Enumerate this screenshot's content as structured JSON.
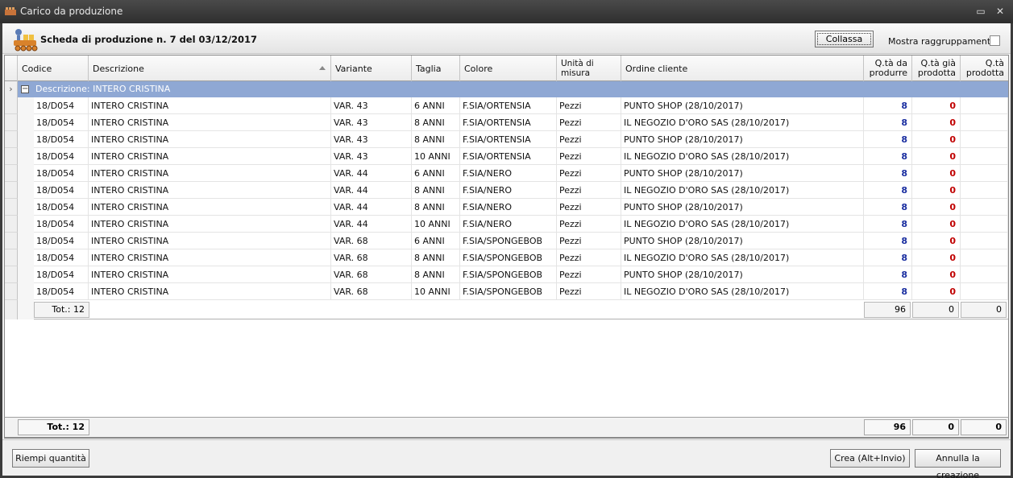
{
  "window": {
    "title": "Carico da produzione"
  },
  "header": {
    "title": "Scheda di produzione n. 7 del 03/12/2017",
    "collapse_label": "Collassa",
    "grouping_label": "Mostra raggruppamento:"
  },
  "columns": [
    "Codice",
    "Descrizione",
    "Variante",
    "Taglia",
    "Colore",
    "Unità di misura",
    "Ordine cliente",
    "Q.tà da produrre",
    "Q.tà già prodotta",
    "Q.tà prodotta"
  ],
  "group": {
    "label": "Descrizione: INTERO CRISTINA"
  },
  "rows": [
    [
      "18/D054",
      "INTERO CRISTINA",
      "VAR. 43",
      "6 ANNI",
      "F.SIA/ORTENSIA",
      "Pezzi",
      "PUNTO SHOP (28/10/2017)",
      "8",
      "0",
      ""
    ],
    [
      "18/D054",
      "INTERO CRISTINA",
      "VAR. 43",
      "8 ANNI",
      "F.SIA/ORTENSIA",
      "Pezzi",
      "IL NEGOZIO D'ORO SAS (28/10/2017)",
      "8",
      "0",
      ""
    ],
    [
      "18/D054",
      "INTERO CRISTINA",
      "VAR. 43",
      "8 ANNI",
      "F.SIA/ORTENSIA",
      "Pezzi",
      "PUNTO SHOP (28/10/2017)",
      "8",
      "0",
      ""
    ],
    [
      "18/D054",
      "INTERO CRISTINA",
      "VAR. 43",
      "10 ANNI",
      "F.SIA/ORTENSIA",
      "Pezzi",
      "IL NEGOZIO D'ORO SAS (28/10/2017)",
      "8",
      "0",
      ""
    ],
    [
      "18/D054",
      "INTERO CRISTINA",
      "VAR. 44",
      "6 ANNI",
      "F.SIA/NERO",
      "Pezzi",
      "PUNTO SHOP (28/10/2017)",
      "8",
      "0",
      ""
    ],
    [
      "18/D054",
      "INTERO CRISTINA",
      "VAR. 44",
      "8 ANNI",
      "F.SIA/NERO",
      "Pezzi",
      "IL NEGOZIO D'ORO SAS (28/10/2017)",
      "8",
      "0",
      ""
    ],
    [
      "18/D054",
      "INTERO CRISTINA",
      "VAR. 44",
      "8 ANNI",
      "F.SIA/NERO",
      "Pezzi",
      "PUNTO SHOP (28/10/2017)",
      "8",
      "0",
      ""
    ],
    [
      "18/D054",
      "INTERO CRISTINA",
      "VAR. 44",
      "10 ANNI",
      "F.SIA/NERO",
      "Pezzi",
      "IL NEGOZIO D'ORO SAS (28/10/2017)",
      "8",
      "0",
      ""
    ],
    [
      "18/D054",
      "INTERO CRISTINA",
      "VAR. 68",
      "6 ANNI",
      "F.SIA/SPONGEBOB",
      "Pezzi",
      "PUNTO SHOP (28/10/2017)",
      "8",
      "0",
      ""
    ],
    [
      "18/D054",
      "INTERO CRISTINA",
      "VAR. 68",
      "8 ANNI",
      "F.SIA/SPONGEBOB",
      "Pezzi",
      "IL NEGOZIO D'ORO SAS (28/10/2017)",
      "8",
      "0",
      ""
    ],
    [
      "18/D054",
      "INTERO CRISTINA",
      "VAR. 68",
      "8 ANNI",
      "F.SIA/SPONGEBOB",
      "Pezzi",
      "PUNTO SHOP (28/10/2017)",
      "8",
      "0",
      ""
    ],
    [
      "18/D054",
      "INTERO CRISTINA",
      "VAR. 68",
      "10 ANNI",
      "F.SIA/SPONGEBOB",
      "Pezzi",
      "IL NEGOZIO D'ORO SAS (28/10/2017)",
      "8",
      "0",
      ""
    ]
  ],
  "group_totals": {
    "count": "Tot.: 12",
    "q_da_produrre": "96",
    "q_gia_prodotta": "0",
    "q_prodotta": "0"
  },
  "grand_totals": {
    "count": "Tot.: 12",
    "q_da_produrre": "96",
    "q_gia_prodotta": "0",
    "q_prodotta": "0"
  },
  "buttons": {
    "fill_quantity": "Riempi quantità",
    "create": "Crea (Alt+Invio)",
    "cancel": "Annulla la creazione"
  },
  "colors": {
    "group_band": "#8fa8d4",
    "qty_to_produce": "#1a2ea0",
    "qty_produced": "#c00000"
  }
}
